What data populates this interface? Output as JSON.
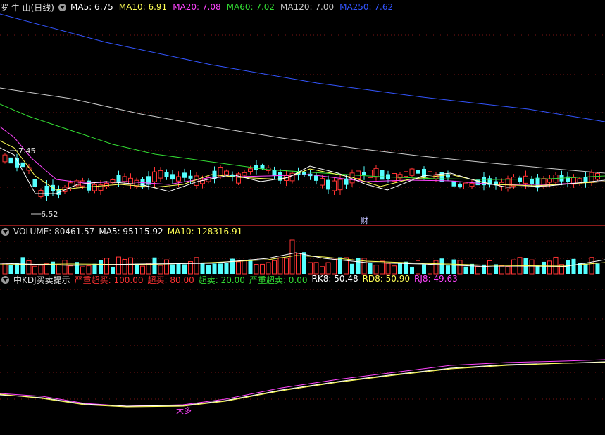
{
  "price_panel": {
    "title": "罗 牛 山(日线)",
    "ma": [
      {
        "label": "MA5: 6.75",
        "color": "#ffffff"
      },
      {
        "label": "MA10: 6.91",
        "color": "#ffff55"
      },
      {
        "label": "MA20: 7.08",
        "color": "#ff44ff"
      },
      {
        "label": "MA60: 7.02",
        "color": "#33dd33"
      },
      {
        "label": "MA120: 7.00",
        "color": "#cccccc"
      },
      {
        "label": "MA250: 7.62",
        "color": "#3355ff"
      }
    ],
    "high_label": "7.45",
    "low_label": "6.52",
    "event_label": "财"
  },
  "volume_panel": {
    "title": "VOLUME: 80461.57",
    "ma5": "MA5: 95115.92",
    "ma10": "MA10: 128316.91"
  },
  "kdj_panel": {
    "title": "中KDJ买卖提示",
    "items": [
      {
        "label": "严重超买: 100.00",
        "color": "#ff3333"
      },
      {
        "label": "超买: 80.00",
        "color": "#ff3333"
      },
      {
        "label": "超卖: 20.00",
        "color": "#33dd33"
      },
      {
        "label": "严重超卖: 0.00",
        "color": "#33dd33"
      },
      {
        "label": "RK8: 50.48",
        "color": "#ffffff"
      },
      {
        "label": "RD8: 50.90",
        "color": "#ffff55"
      },
      {
        "label": "RJ8: 49.63",
        "color": "#ff44ff"
      }
    ],
    "signal_label": "大多"
  },
  "colors": {
    "up": "#ff3333",
    "down": "#55ffff",
    "grid": "#8b1a1a"
  }
}
